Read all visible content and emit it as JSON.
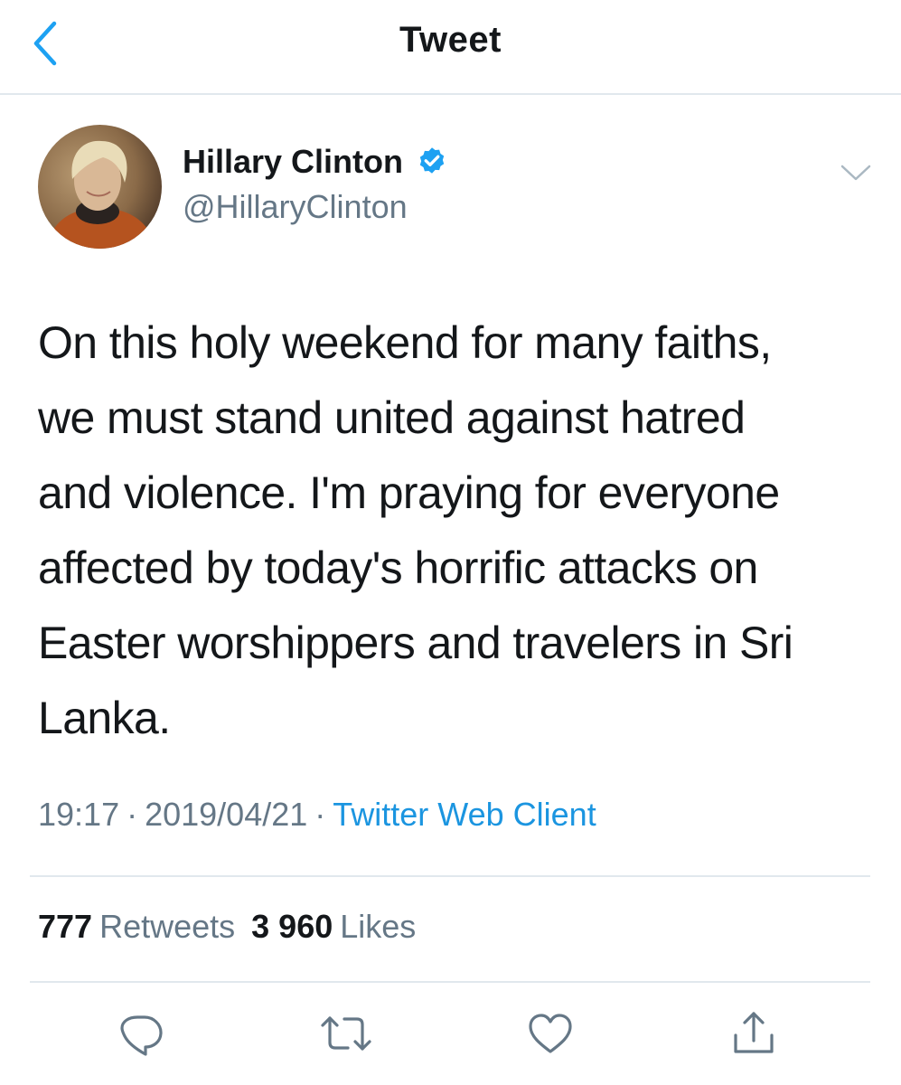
{
  "header": {
    "title": "Tweet",
    "back_icon": "chevron-left-icon"
  },
  "author": {
    "display_name": "Hillary Clinton",
    "handle": "@HillaryClinton",
    "verified_icon": "verified-badge-icon",
    "menu_icon": "chevron-down-icon"
  },
  "tweet": {
    "text": "On this holy weekend for many faiths,\nwe must stand united against hatred\nand violence. I'm praying for everyone\naffected by today's horrific attacks on\nEaster worshippers and travelers in Sri\nLanka.",
    "time": "19:17",
    "date": "2019/04/21",
    "separator": "·",
    "source": "Twitter Web Client"
  },
  "stats": {
    "retweets_count": "777",
    "retweets_label": "Retweets",
    "likes_count": "3 960",
    "likes_label": "Likes"
  },
  "actions": {
    "reply_icon": "reply-icon",
    "retweet_icon": "retweet-icon",
    "like_icon": "heart-icon",
    "share_icon": "share-icon"
  },
  "colors": {
    "accent": "#1da1f2",
    "link": "#1b95e0",
    "secondary_text": "#657786",
    "divider": "#e1e8ed"
  }
}
